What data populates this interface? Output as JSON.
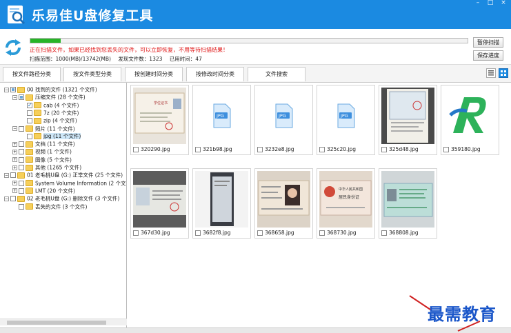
{
  "app": {
    "title": "乐易佳U盘修复工具"
  },
  "scan": {
    "progress_percent": 7,
    "message": "正在扫描文件，如果已经找到您丢失的文件，可以立即恢复，不用等待扫描结果！",
    "range": "扫描范围：1000(MB)/13742(MB)",
    "found": "发现文件数：1323",
    "time": "已用时间：47",
    "pause": "暂停扫描",
    "save": "保存进度"
  },
  "tabs": [
    "按文件路径分类",
    "按文件类型分类",
    "按创建时间分类",
    "按修改时间分类",
    "文件搜索"
  ],
  "tree": [
    {
      "text": "00 找到的文件  (1321 个文件)",
      "exp": "-",
      "cb": "part",
      "fold": true
    },
    {
      "text": "压缩文件  (28 个文件)",
      "exp": "-",
      "cb": "part",
      "fold": true
    },
    {
      "text": "cab  (4 个文件)",
      "exp": "",
      "cb": "chk",
      "fold": true
    },
    {
      "text": "7z  (20 个文件)",
      "exp": "",
      "cb": "",
      "fold": true
    },
    {
      "text": "zip  (4 个文件)",
      "exp": "",
      "cb": "",
      "fold": true
    },
    {
      "text": "照片  (11 个文件)",
      "exp": "-",
      "cb": "",
      "fold": true
    },
    {
      "text": "jpg  (11 个文件)",
      "exp": "",
      "cb": "",
      "fold": true,
      "sel": true
    },
    {
      "text": "文档  (11 个文件)",
      "exp": "+",
      "cb": "",
      "fold": true
    },
    {
      "text": "视频  (1 个文件)",
      "exp": "+",
      "cb": "",
      "fold": true
    },
    {
      "text": "图像  (5 个文件)",
      "exp": "+",
      "cb": "",
      "fold": true
    },
    {
      "text": "其他  (1265 个文件)",
      "exp": "+",
      "cb": "",
      "fold": true
    },
    {
      "text": "01 老毛桃U盘 (G:) 正常文件 (25 个文件)",
      "exp": "-",
      "cb": "",
      "fold": true
    },
    {
      "text": "System Volume Information  (2 个文件)",
      "exp": "+",
      "cb": "",
      "fold": true
    },
    {
      "text": "LMT  (20 个文件)",
      "exp": "+",
      "cb": "",
      "fold": true
    },
    {
      "text": "02 老毛桃U盘 (G:) 删除文件 (3 个文件)",
      "exp": "-",
      "cb": "",
      "fold": true
    },
    {
      "text": "丢失的文件  (3 个文件)",
      "exp": "",
      "cb": "",
      "fold": true
    }
  ],
  "files": [
    {
      "name": "320290.jpg",
      "kind": "cert"
    },
    {
      "name": "321b98.jpg",
      "kind": "icon",
      "label": "JPG"
    },
    {
      "name": "3232e8.jpg",
      "kind": "icon",
      "label": "JPG"
    },
    {
      "name": "325c20.jpg",
      "kind": "icon",
      "label": "JPG"
    },
    {
      "name": "325d48.jpg",
      "kind": "doc"
    },
    {
      "name": "359180.jpg",
      "kind": "logo"
    },
    {
      "name": "367d30.jpg",
      "kind": "cert2"
    },
    {
      "name": "3682f8.jpg",
      "kind": "phone"
    },
    {
      "name": "368658.jpg",
      "kind": "idfront"
    },
    {
      "name": "368730.jpg",
      "kind": "idback"
    },
    {
      "name": "368808.jpg",
      "kind": "card"
    }
  ],
  "watermark": "最需教育",
  "colors": {
    "titlebar": "#1b8ae1",
    "progress": "#27b427",
    "message": "#e01818"
  }
}
